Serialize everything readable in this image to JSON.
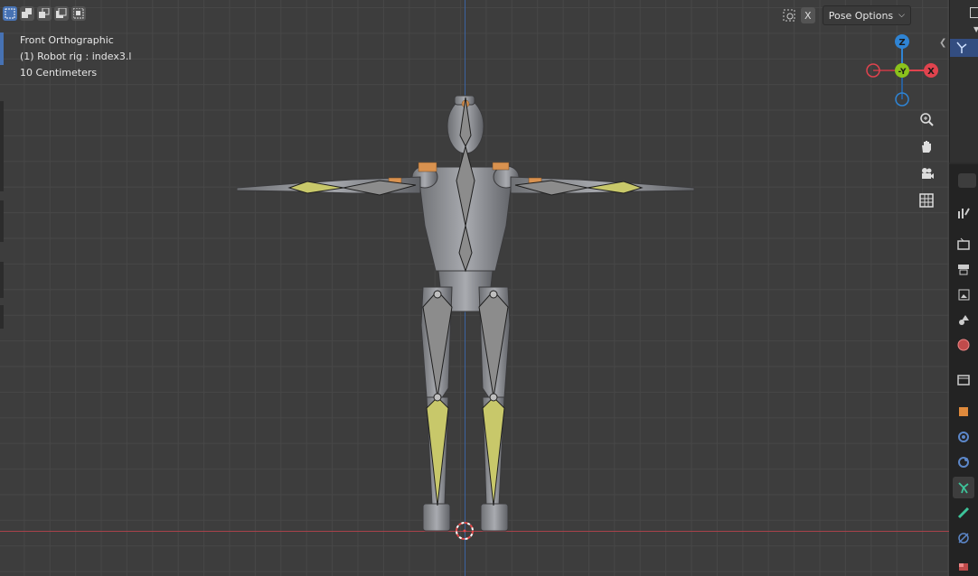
{
  "viewport": {
    "info_lines": [
      "Front Orthographic",
      "(1) Robot rig : index3.l",
      "10 Centimeters"
    ]
  },
  "header": {
    "select_modes": [
      "select-set-icon",
      "select-extend-icon",
      "select-subtract-icon",
      "select-invert-icon",
      "select-intersect-icon"
    ],
    "xray_label": "X",
    "pose_options_label": "Pose Options"
  },
  "gizmo": {
    "z_label": "Z",
    "y_label": "-Y",
    "x_label": "X",
    "colors": {
      "x": "#e0434e",
      "y": "#8bc21c",
      "z": "#2f84d4"
    }
  },
  "navigation": [
    "zoom-icon",
    "pan-hand-icon",
    "camera-view-icon",
    "ortho-grid-icon"
  ],
  "properties_tabs": [
    "tool-icon",
    "render-icon",
    "output-icon",
    "view-layer-icon",
    "scene-icon",
    "world-icon",
    "collection-icon",
    "object-icon",
    "modifier-icon",
    "physics-icon",
    "object-data-armature-icon",
    "bone-icon",
    "bone-constraint-icon",
    "texture-icon"
  ],
  "colors": {
    "accent": "#4772b3",
    "bone_selected": "#c8c86a",
    "bone_default": "#8c8c8c"
  }
}
